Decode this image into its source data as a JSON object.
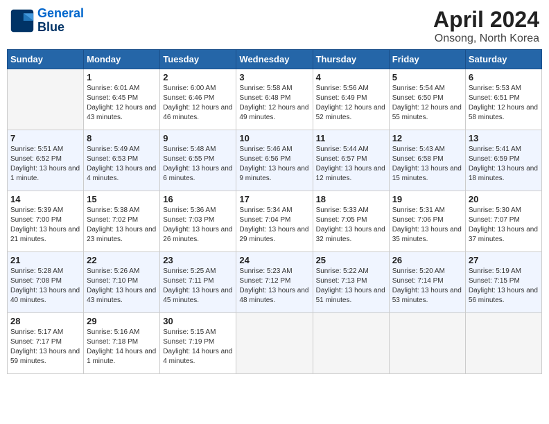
{
  "header": {
    "logo_line1": "General",
    "logo_line2": "Blue",
    "month": "April 2024",
    "location": "Onsong, North Korea"
  },
  "weekdays": [
    "Sunday",
    "Monday",
    "Tuesday",
    "Wednesday",
    "Thursday",
    "Friday",
    "Saturday"
  ],
  "weeks": [
    [
      {
        "day": "",
        "empty": true
      },
      {
        "day": "1",
        "sunrise": "6:01 AM",
        "sunset": "6:45 PM",
        "daylight": "12 hours and 43 minutes."
      },
      {
        "day": "2",
        "sunrise": "6:00 AM",
        "sunset": "6:46 PM",
        "daylight": "12 hours and 46 minutes."
      },
      {
        "day": "3",
        "sunrise": "5:58 AM",
        "sunset": "6:48 PM",
        "daylight": "12 hours and 49 minutes."
      },
      {
        "day": "4",
        "sunrise": "5:56 AM",
        "sunset": "6:49 PM",
        "daylight": "12 hours and 52 minutes."
      },
      {
        "day": "5",
        "sunrise": "5:54 AM",
        "sunset": "6:50 PM",
        "daylight": "12 hours and 55 minutes."
      },
      {
        "day": "6",
        "sunrise": "5:53 AM",
        "sunset": "6:51 PM",
        "daylight": "12 hours and 58 minutes."
      }
    ],
    [
      {
        "day": "7",
        "sunrise": "5:51 AM",
        "sunset": "6:52 PM",
        "daylight": "13 hours and 1 minute."
      },
      {
        "day": "8",
        "sunrise": "5:49 AM",
        "sunset": "6:53 PM",
        "daylight": "13 hours and 4 minutes."
      },
      {
        "day": "9",
        "sunrise": "5:48 AM",
        "sunset": "6:55 PM",
        "daylight": "13 hours and 6 minutes."
      },
      {
        "day": "10",
        "sunrise": "5:46 AM",
        "sunset": "6:56 PM",
        "daylight": "13 hours and 9 minutes."
      },
      {
        "day": "11",
        "sunrise": "5:44 AM",
        "sunset": "6:57 PM",
        "daylight": "13 hours and 12 minutes."
      },
      {
        "day": "12",
        "sunrise": "5:43 AM",
        "sunset": "6:58 PM",
        "daylight": "13 hours and 15 minutes."
      },
      {
        "day": "13",
        "sunrise": "5:41 AM",
        "sunset": "6:59 PM",
        "daylight": "13 hours and 18 minutes."
      }
    ],
    [
      {
        "day": "14",
        "sunrise": "5:39 AM",
        "sunset": "7:00 PM",
        "daylight": "13 hours and 21 minutes."
      },
      {
        "day": "15",
        "sunrise": "5:38 AM",
        "sunset": "7:02 PM",
        "daylight": "13 hours and 23 minutes."
      },
      {
        "day": "16",
        "sunrise": "5:36 AM",
        "sunset": "7:03 PM",
        "daylight": "13 hours and 26 minutes."
      },
      {
        "day": "17",
        "sunrise": "5:34 AM",
        "sunset": "7:04 PM",
        "daylight": "13 hours and 29 minutes."
      },
      {
        "day": "18",
        "sunrise": "5:33 AM",
        "sunset": "7:05 PM",
        "daylight": "13 hours and 32 minutes."
      },
      {
        "day": "19",
        "sunrise": "5:31 AM",
        "sunset": "7:06 PM",
        "daylight": "13 hours and 35 minutes."
      },
      {
        "day": "20",
        "sunrise": "5:30 AM",
        "sunset": "7:07 PM",
        "daylight": "13 hours and 37 minutes."
      }
    ],
    [
      {
        "day": "21",
        "sunrise": "5:28 AM",
        "sunset": "7:08 PM",
        "daylight": "13 hours and 40 minutes."
      },
      {
        "day": "22",
        "sunrise": "5:26 AM",
        "sunset": "7:10 PM",
        "daylight": "13 hours and 43 minutes."
      },
      {
        "day": "23",
        "sunrise": "5:25 AM",
        "sunset": "7:11 PM",
        "daylight": "13 hours and 45 minutes."
      },
      {
        "day": "24",
        "sunrise": "5:23 AM",
        "sunset": "7:12 PM",
        "daylight": "13 hours and 48 minutes."
      },
      {
        "day": "25",
        "sunrise": "5:22 AM",
        "sunset": "7:13 PM",
        "daylight": "13 hours and 51 minutes."
      },
      {
        "day": "26",
        "sunrise": "5:20 AM",
        "sunset": "7:14 PM",
        "daylight": "13 hours and 53 minutes."
      },
      {
        "day": "27",
        "sunrise": "5:19 AM",
        "sunset": "7:15 PM",
        "daylight": "13 hours and 56 minutes."
      }
    ],
    [
      {
        "day": "28",
        "sunrise": "5:17 AM",
        "sunset": "7:17 PM",
        "daylight": "13 hours and 59 minutes."
      },
      {
        "day": "29",
        "sunrise": "5:16 AM",
        "sunset": "7:18 PM",
        "daylight": "14 hours and 1 minute."
      },
      {
        "day": "30",
        "sunrise": "5:15 AM",
        "sunset": "7:19 PM",
        "daylight": "14 hours and 4 minutes."
      },
      {
        "day": "",
        "empty": true
      },
      {
        "day": "",
        "empty": true
      },
      {
        "day": "",
        "empty": true
      },
      {
        "day": "",
        "empty": true
      }
    ]
  ]
}
